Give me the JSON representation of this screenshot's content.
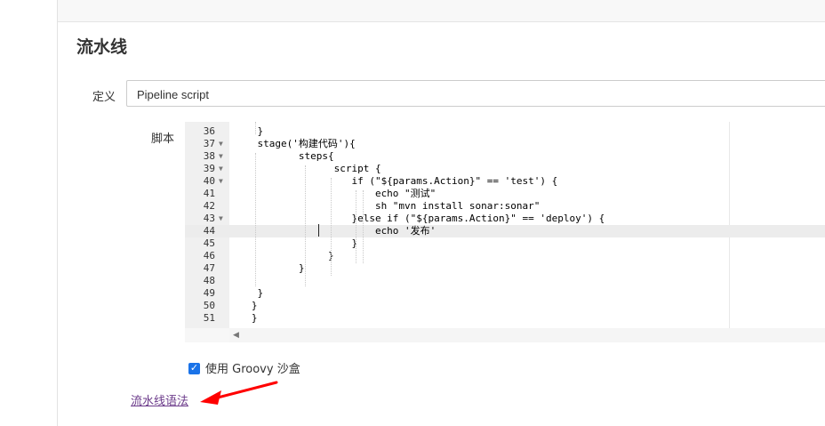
{
  "section": {
    "title": "流水线"
  },
  "definition": {
    "label": "定义",
    "value": "Pipeline script"
  },
  "script": {
    "label": "脚本",
    "active_line": "44",
    "lines": [
      {
        "num": "36",
        "code": "    }"
      },
      {
        "num": "37",
        "code": "    stage('构建代码'){"
      },
      {
        "num": "38",
        "code": "           steps{"
      },
      {
        "num": "39",
        "code": "                 script {"
      },
      {
        "num": "40",
        "code": "                    if (\"${params.Action}\" == 'test') {"
      },
      {
        "num": "41",
        "code": "                        echo \"测试\""
      },
      {
        "num": "42",
        "code": "                        sh \"mvn install sonar:sonar\""
      },
      {
        "num": "43",
        "code": "                    }else if (\"${params.Action}\" == 'deploy') {"
      },
      {
        "num": "44",
        "code": "                        echo '发布'"
      },
      {
        "num": "45",
        "code": "                    }"
      },
      {
        "num": "46",
        "code": "                }"
      },
      {
        "num": "47",
        "code": "           }"
      },
      {
        "num": "48",
        "code": ""
      },
      {
        "num": "49",
        "code": "    }"
      },
      {
        "num": "50",
        "code": "   }"
      },
      {
        "num": "51",
        "code": "   }"
      }
    ],
    "fold_markers": [
      "37",
      "38",
      "39",
      "40",
      "43"
    ]
  },
  "sandbox": {
    "label": "使用 Groovy 沙盒",
    "checked": true
  },
  "syntax_link": {
    "label": "流水线语法"
  },
  "annotation": {
    "arrow_color": "#ff0000"
  }
}
